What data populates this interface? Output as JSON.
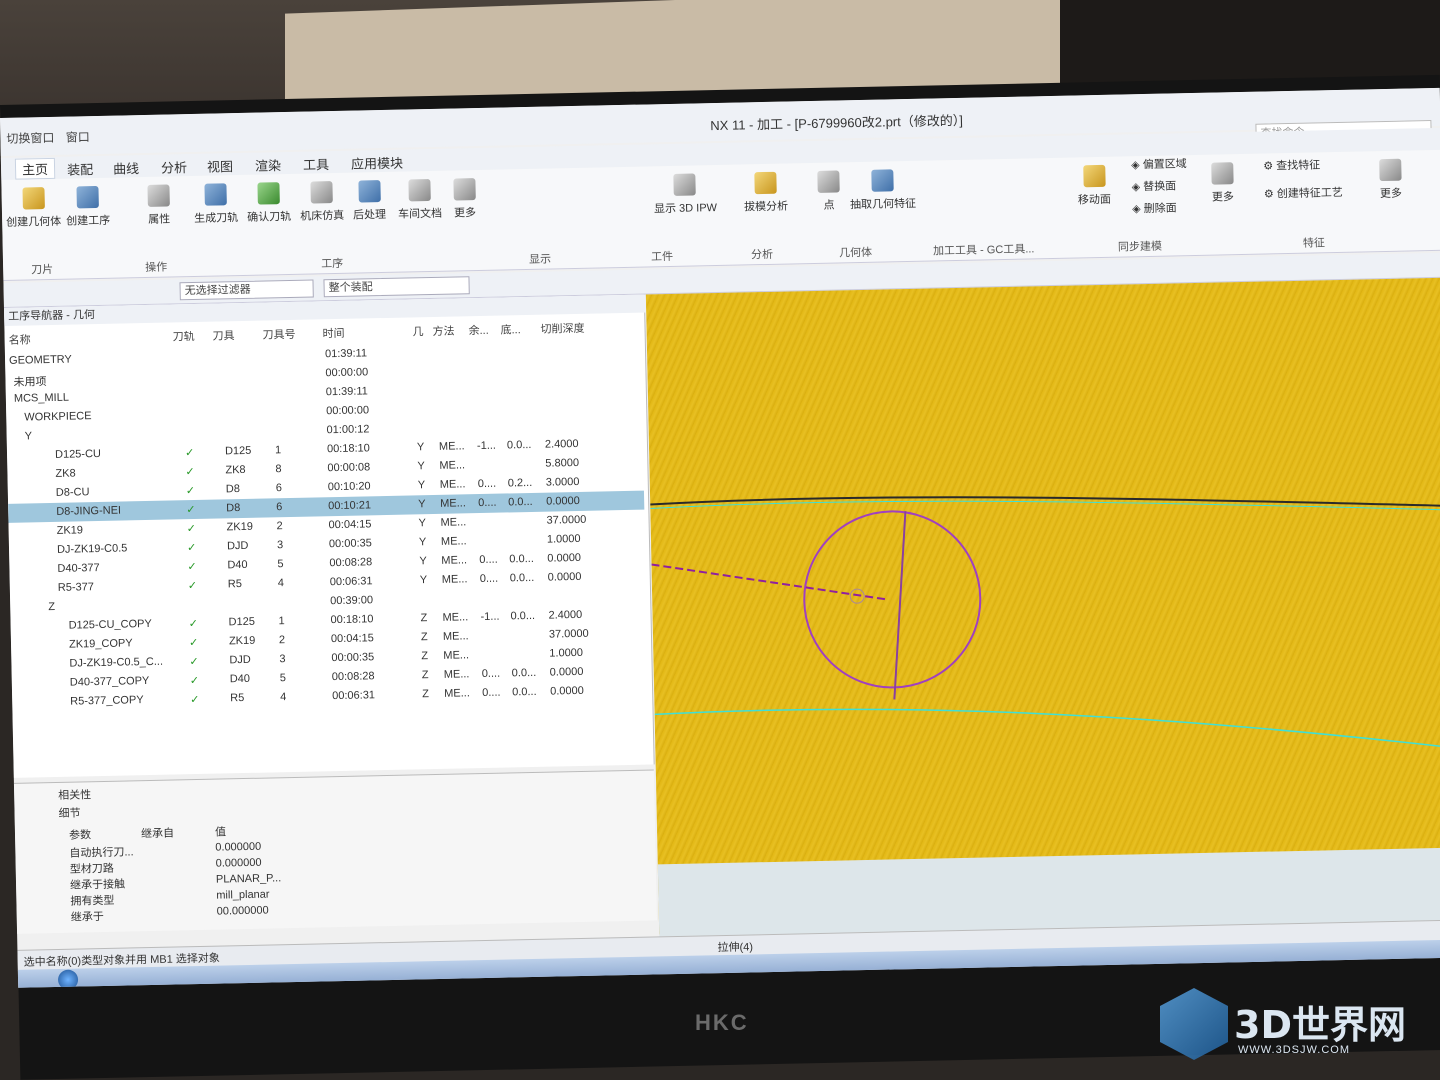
{
  "window": {
    "title": "NX 11 - 加工 - [P-6799960改2.prt（修改的）]",
    "quick_access": [
      "切换窗口",
      "窗口"
    ],
    "search_placeholder": "查找命令"
  },
  "menu": {
    "items": [
      "主页",
      "装配",
      "曲线",
      "分析",
      "视图",
      "渲染",
      "工具",
      "应用模块"
    ]
  },
  "ribbon": {
    "buttons": [
      "创建几何体",
      "创建工序",
      "属性",
      "生成刀轨",
      "确认刀轨",
      "机床仿真",
      "后处理",
      "车间文档",
      "更多",
      "显示 3D IPW",
      "拔模分析",
      "点",
      "抽取几何特征",
      "移动面",
      "偏置区域",
      "替换面",
      "删除面",
      "更多",
      "查找特征",
      "创建特征工艺",
      "更多"
    ],
    "groups": [
      "刀片",
      "操作",
      "工序",
      "显示",
      "工件",
      "分析",
      "几何体",
      "加工工具 - GC工具...",
      "同步建模",
      "特征"
    ]
  },
  "toolbar2": {
    "filter": "无选择过滤器",
    "assembly": "整个装配"
  },
  "navigator": {
    "title": "工序导航器 - 几何",
    "columns": [
      "名称",
      "刀轨",
      "刀具",
      "刀具号",
      "时间",
      "几",
      "方法",
      "余...",
      "底...",
      "切削深度"
    ],
    "rows": [
      {
        "name": "GEOMETRY",
        "tool": "",
        "num": "",
        "time": "01:39:11",
        "g": "",
        "method": "",
        "r": "",
        "f": "",
        "depth": ""
      },
      {
        "name": "未用项",
        "tool": "",
        "num": "",
        "time": "00:00:00",
        "g": "",
        "method": "",
        "r": "",
        "f": "",
        "depth": ""
      },
      {
        "name": "MCS_MILL",
        "tool": "",
        "num": "",
        "time": "01:39:11",
        "g": "",
        "method": "",
        "r": "",
        "f": "",
        "depth": ""
      },
      {
        "name": "WORKPIECE",
        "tool": "",
        "num": "",
        "time": "00:00:00",
        "g": "",
        "method": "",
        "r": "",
        "f": "",
        "depth": ""
      },
      {
        "name": "Y",
        "tool": "",
        "num": "",
        "time": "01:00:12",
        "g": "",
        "method": "",
        "r": "",
        "f": "",
        "depth": ""
      },
      {
        "name": "D125-CU",
        "tool": "D125",
        "num": "1",
        "time": "00:18:10",
        "g": "Y",
        "method": "ME...",
        "r": "-1...",
        "f": "0.0...",
        "depth": "2.4000"
      },
      {
        "name": "ZK8",
        "tool": "ZK8",
        "num": "8",
        "time": "00:00:08",
        "g": "Y",
        "method": "ME...",
        "r": "",
        "f": "",
        "depth": "5.8000"
      },
      {
        "name": "D8-CU",
        "tool": "D8",
        "num": "6",
        "time": "00:10:20",
        "g": "Y",
        "method": "ME...",
        "r": "0....",
        "f": "0.2...",
        "depth": "3.0000"
      },
      {
        "name": "D8-JING-NEI",
        "tool": "D8",
        "num": "6",
        "time": "00:10:21",
        "g": "Y",
        "method": "ME...",
        "r": "0....",
        "f": "0.0...",
        "depth": "0.0000",
        "selected": true
      },
      {
        "name": "ZK19",
        "tool": "ZK19",
        "num": "2",
        "time": "00:04:15",
        "g": "Y",
        "method": "ME...",
        "r": "",
        "f": "",
        "depth": "37.0000"
      },
      {
        "name": "DJ-ZK19-C0.5",
        "tool": "DJD",
        "num": "3",
        "time": "00:00:35",
        "g": "Y",
        "method": "ME...",
        "r": "",
        "f": "",
        "depth": "1.0000"
      },
      {
        "name": "D40-377",
        "tool": "D40",
        "num": "5",
        "time": "00:08:28",
        "g": "Y",
        "method": "ME...",
        "r": "0....",
        "f": "0.0...",
        "depth": "0.0000"
      },
      {
        "name": "R5-377",
        "tool": "R5",
        "num": "4",
        "time": "00:06:31",
        "g": "Y",
        "method": "ME...",
        "r": "0....",
        "f": "0.0...",
        "depth": "0.0000"
      },
      {
        "name": "Z",
        "tool": "",
        "num": "",
        "time": "00:39:00",
        "g": "",
        "method": "",
        "r": "",
        "f": "",
        "depth": ""
      },
      {
        "name": "D125-CU_COPY",
        "tool": "D125",
        "num": "1",
        "time": "00:18:10",
        "g": "Z",
        "method": "ME...",
        "r": "-1...",
        "f": "0.0...",
        "depth": "2.4000"
      },
      {
        "name": "ZK19_COPY",
        "tool": "ZK19",
        "num": "2",
        "time": "00:04:15",
        "g": "Z",
        "method": "ME...",
        "r": "",
        "f": "",
        "depth": "37.0000"
      },
      {
        "name": "DJ-ZK19-C0.5_C...",
        "tool": "DJD",
        "num": "3",
        "time": "00:00:35",
        "g": "Z",
        "method": "ME...",
        "r": "",
        "f": "",
        "depth": "1.0000"
      },
      {
        "name": "D40-377_COPY",
        "tool": "D40",
        "num": "5",
        "time": "00:08:28",
        "g": "Z",
        "method": "ME...",
        "r": "0....",
        "f": "0.0...",
        "depth": "0.0000"
      },
      {
        "name": "R5-377_COPY",
        "tool": "R5",
        "num": "4",
        "time": "00:06:31",
        "g": "Z",
        "method": "ME...",
        "r": "0....",
        "f": "0.0...",
        "depth": "0.0000"
      }
    ]
  },
  "details": {
    "related_label": "相关性",
    "details_label": "细节",
    "cols": [
      "参数",
      "继承自",
      "值"
    ],
    "params": [
      "自动执行刀...",
      "型材刀路",
      "继承于接触",
      "拥有类型",
      "继承于"
    ],
    "values": [
      "0.000000",
      "0.000000",
      "PLANAR_P...",
      "mill_planar",
      "00.000000"
    ]
  },
  "status": {
    "left": "选中名称(0)类型对象并用 MB1 选择对象",
    "center": "拉伸(4)"
  },
  "monitor_brand": "HKC",
  "watermark": {
    "title": "3D世界网",
    "url": "WWW.3DSJW.COM"
  }
}
